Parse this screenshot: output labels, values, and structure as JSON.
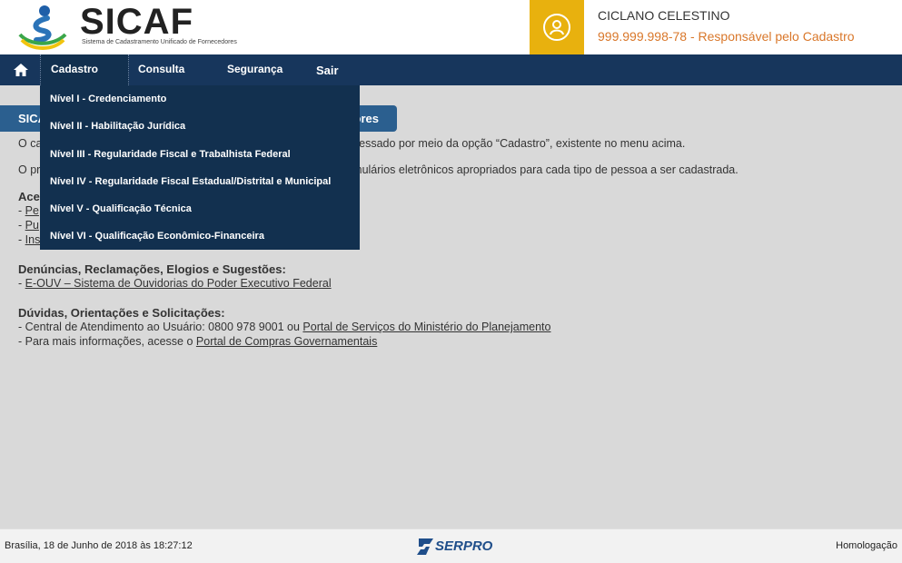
{
  "header": {
    "logo_title": "SICAF",
    "logo_subtitle": "Sistema de Cadastramento Unificado de Fornecedores",
    "user_name": "CICLANO CELESTINO",
    "user_role": "999.999.998-78 - Responsável pelo Cadastro"
  },
  "colors": {
    "navbar": "#17365c",
    "user_box": "#e8b10e",
    "role_text": "#d9772a",
    "section_tab": "#2b5f8f"
  },
  "nav": {
    "home_icon": "home-icon",
    "items": [
      "Cadastro",
      "Consulta",
      "Segurança",
      "Sair"
    ]
  },
  "dropdown": {
    "items": [
      "Nível I - Credenciamento",
      "Nível II - Habilitação Jurídica",
      "Nível III - Regularidade Fiscal e Trabalhista Federal",
      "Nível IV - Regularidade Fiscal Estadual/Distrital e Municipal",
      "Nível V - Qualificação Técnica",
      "Nível VI - Qualificação Econômico-Financeira"
    ]
  },
  "content": {
    "tab_left": "SICA",
    "tab_right": "ores",
    "para1_left": "O ca",
    "para1_right": "eressado por meio da opção “Cadastro”, existente no menu acima.",
    "para2_left": "O pr",
    "para2_right": "rmulários eletrônicos apropriados para cada tipo de pessoa a ser cadastrada.",
    "access_heading": "Ace",
    "access_links": [
      "Pe",
      "Pu",
      "Ins"
    ],
    "denuncias_heading": "Denúncias, Reclamações, Elogios e Sugestões:",
    "denuncias_link": "E-OUV – Sistema de Ouvidorias do Poder Executivo Federal",
    "duvidas_heading": "Dúvidas, Orientações e Solicitações:",
    "central_text": "- Central de Atendimento ao Usuário: 0800 978 9001 ou ",
    "central_link": "Portal de Serviços do Ministério do Planejamento",
    "info_text": "- Para mais informações, acesse o ",
    "info_link": "Portal de Compras Governamentais",
    "dash": "- "
  },
  "footer": {
    "datetime": "Brasília, 18 de Junho de 2018 às 18:27:12",
    "logo": "SERPRO",
    "environment": "Homologação"
  }
}
